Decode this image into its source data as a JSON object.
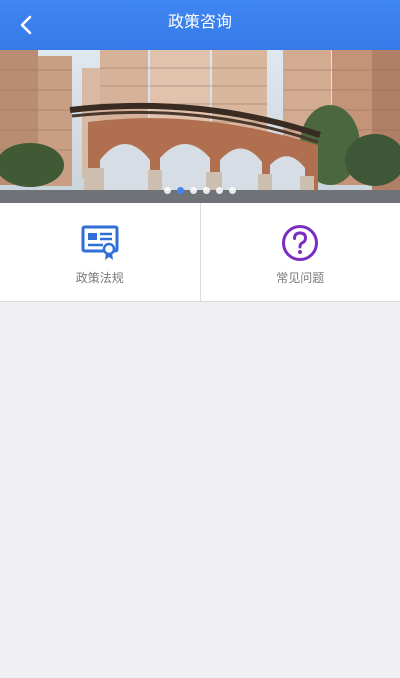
{
  "header": {
    "title": "政策咨询",
    "back_icon": "chevron-left-icon",
    "bg_color": "#3f86f2"
  },
  "banner": {
    "slide_count": 6,
    "active_index": 1,
    "active_dot_color": "#3f86f2"
  },
  "menu": [
    {
      "label": "政策法规",
      "icon": "certificate-document-icon",
      "color": "#2f6fd6"
    },
    {
      "label": "常见问题",
      "icon": "question-circle-icon",
      "color": "#7b2fbf"
    }
  ]
}
